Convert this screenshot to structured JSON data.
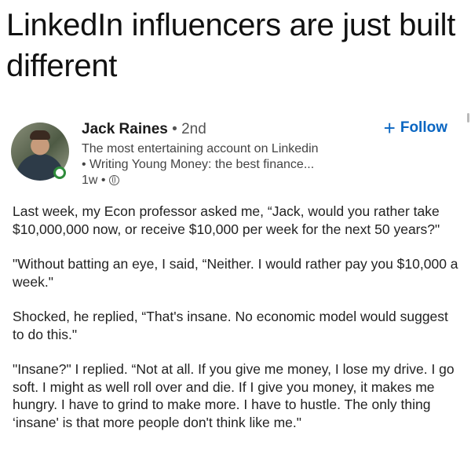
{
  "headline": "LinkedIn influencers are just built different",
  "post": {
    "author_name": "Jack Raines",
    "connection_degree": "2nd",
    "headline_line1": "The most entertaining account on Linkedin",
    "headline_line2": "• Writing Young Money: the best finance...",
    "time_ago": "1w",
    "follow_label": "Follow",
    "paragraphs": [
      "Last week, my Econ professor asked me, “Jack, would you rather take $10,000,000 now, or receive $10,000 per week for the next 50 years?\"",
      "\"Without batting an eye, I said, “Neither. I would rather pay you $10,000 a week.\"",
      "Shocked, he replied, “That's insane. No economic model would suggest to do this.\"",
      "\"Insane?\" I replied. “Not at all. If you give me money, I lose my drive. I go soft. I might as well roll over and die. If I give you money, it makes me hungry. I have to grind to make more. I have to hustle. The only thing ‘insane' is that more people don't think like me.\""
    ]
  },
  "icons": {
    "avatar": "profile-photo",
    "follow": "plus-icon",
    "visibility": "globe-icon",
    "status": "online-ring-icon"
  },
  "colors": {
    "follow_blue": "#0a66c2",
    "online_green": "#2e8b3a"
  }
}
